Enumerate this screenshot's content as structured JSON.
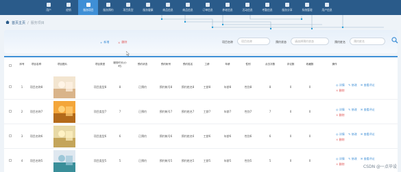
{
  "nav": {
    "items": [
      {
        "label": "用户",
        "active": false
      },
      {
        "label": "经销",
        "active": false
      },
      {
        "label": "服务项目",
        "active": true
      },
      {
        "label": "服务预约",
        "active": false
      },
      {
        "label": "项目类型",
        "active": false
      },
      {
        "label": "服务健康",
        "active": false
      },
      {
        "label": "商品信息",
        "active": false
      },
      {
        "label": "商品信息",
        "active": false
      },
      {
        "label": "订单信息",
        "active": false
      },
      {
        "label": "养老信息",
        "active": false
      },
      {
        "label": "活动信息",
        "active": false
      },
      {
        "label": "考勤信息",
        "active": false
      },
      {
        "label": "服务分享",
        "active": false
      },
      {
        "label": "系统管理",
        "active": false
      },
      {
        "label": "用户信息",
        "active": false
      }
    ]
  },
  "breadcrumb": {
    "home": "首页主页",
    "sep": "/",
    "current": "服务项目"
  },
  "toolbar": {
    "add_label": "新增",
    "delete_label": "删除"
  },
  "search": {
    "name_label": "项目名称",
    "name_placeholder": "项目名称",
    "status_label": "预约状态",
    "status_placeholder": "请选择预约状态",
    "staff_label": "预约姓名",
    "staff_placeholder": "预约姓名"
  },
  "table": {
    "headers": [
      "序号",
      "项目名称",
      "项目图片",
      "项目类型",
      "服务时长(小时)",
      "预约状态",
      "预约帐号",
      "预约姓名",
      "工龄",
      "年龄",
      "性别",
      "点击次数",
      "评论数",
      "收藏数",
      "操作"
    ],
    "actions": {
      "detail": "详情",
      "edit": "修改",
      "review": "查看评论",
      "delete": "删除"
    },
    "rows": [
      {
        "index": "1",
        "name": "项目名称8",
        "type": "项目类型8",
        "hours": "8",
        "status": "已预约",
        "account": "预约帐号8",
        "staff": "预约姓名8",
        "seniority": "工龄8",
        "age": "年龄8",
        "gender": "性别8",
        "clicks": "8",
        "comments": "0",
        "favorites": "0"
      },
      {
        "index": "2",
        "name": "项目名称7",
        "type": "项目类型7",
        "hours": "7",
        "status": "已预约",
        "account": "预约帐号7",
        "staff": "预约姓名7",
        "seniority": "工龄7",
        "age": "年龄7",
        "gender": "性别7",
        "clicks": "7",
        "comments": "0",
        "favorites": "0"
      },
      {
        "index": "3",
        "name": "项目名称6",
        "type": "项目类型6",
        "hours": "6",
        "status": "已预约",
        "account": "预约帐号6",
        "staff": "预约姓名6",
        "seniority": "工龄6",
        "age": "年龄6",
        "gender": "性别6",
        "clicks": "6",
        "comments": "0",
        "favorites": "0"
      },
      {
        "index": "4",
        "name": "项目名称5",
        "type": "项目类型5",
        "hours": "5",
        "status": "已预约",
        "account": "预约帐号5",
        "staff": "预约姓名5",
        "seniority": "工龄5",
        "age": "年龄5",
        "gender": "性别5",
        "clicks": "5",
        "comments": "0",
        "favorites": "0"
      }
    ]
  },
  "watermark": "CSDN @一点毕设",
  "colors": {
    "nav_bg": "#2a5b8a",
    "nav_active": "#3f8fd6",
    "accent": "#3f8fd6",
    "danger": "#e05656"
  }
}
